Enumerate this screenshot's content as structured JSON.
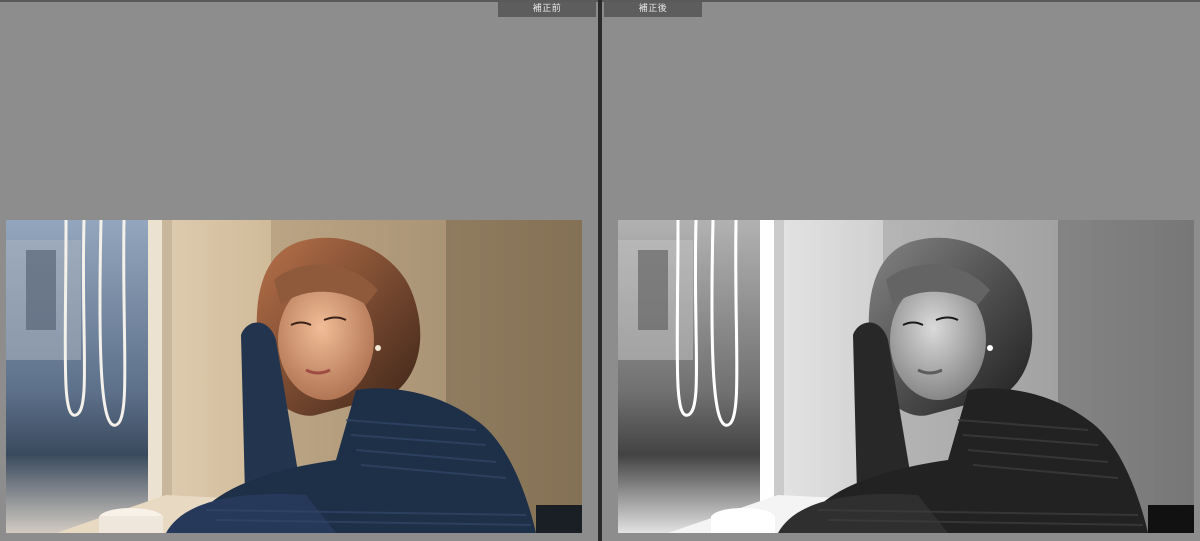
{
  "comparison": {
    "before_label": "補正前",
    "after_label": "補正後"
  },
  "photo": {
    "subject": "woman-at-window-photo",
    "before_mode": "color",
    "after_mode": "monochrome"
  },
  "colors": {
    "panel_background": "#8d8d8d",
    "label_background": "#5d5d5d",
    "divider": "#2b2b2b"
  }
}
